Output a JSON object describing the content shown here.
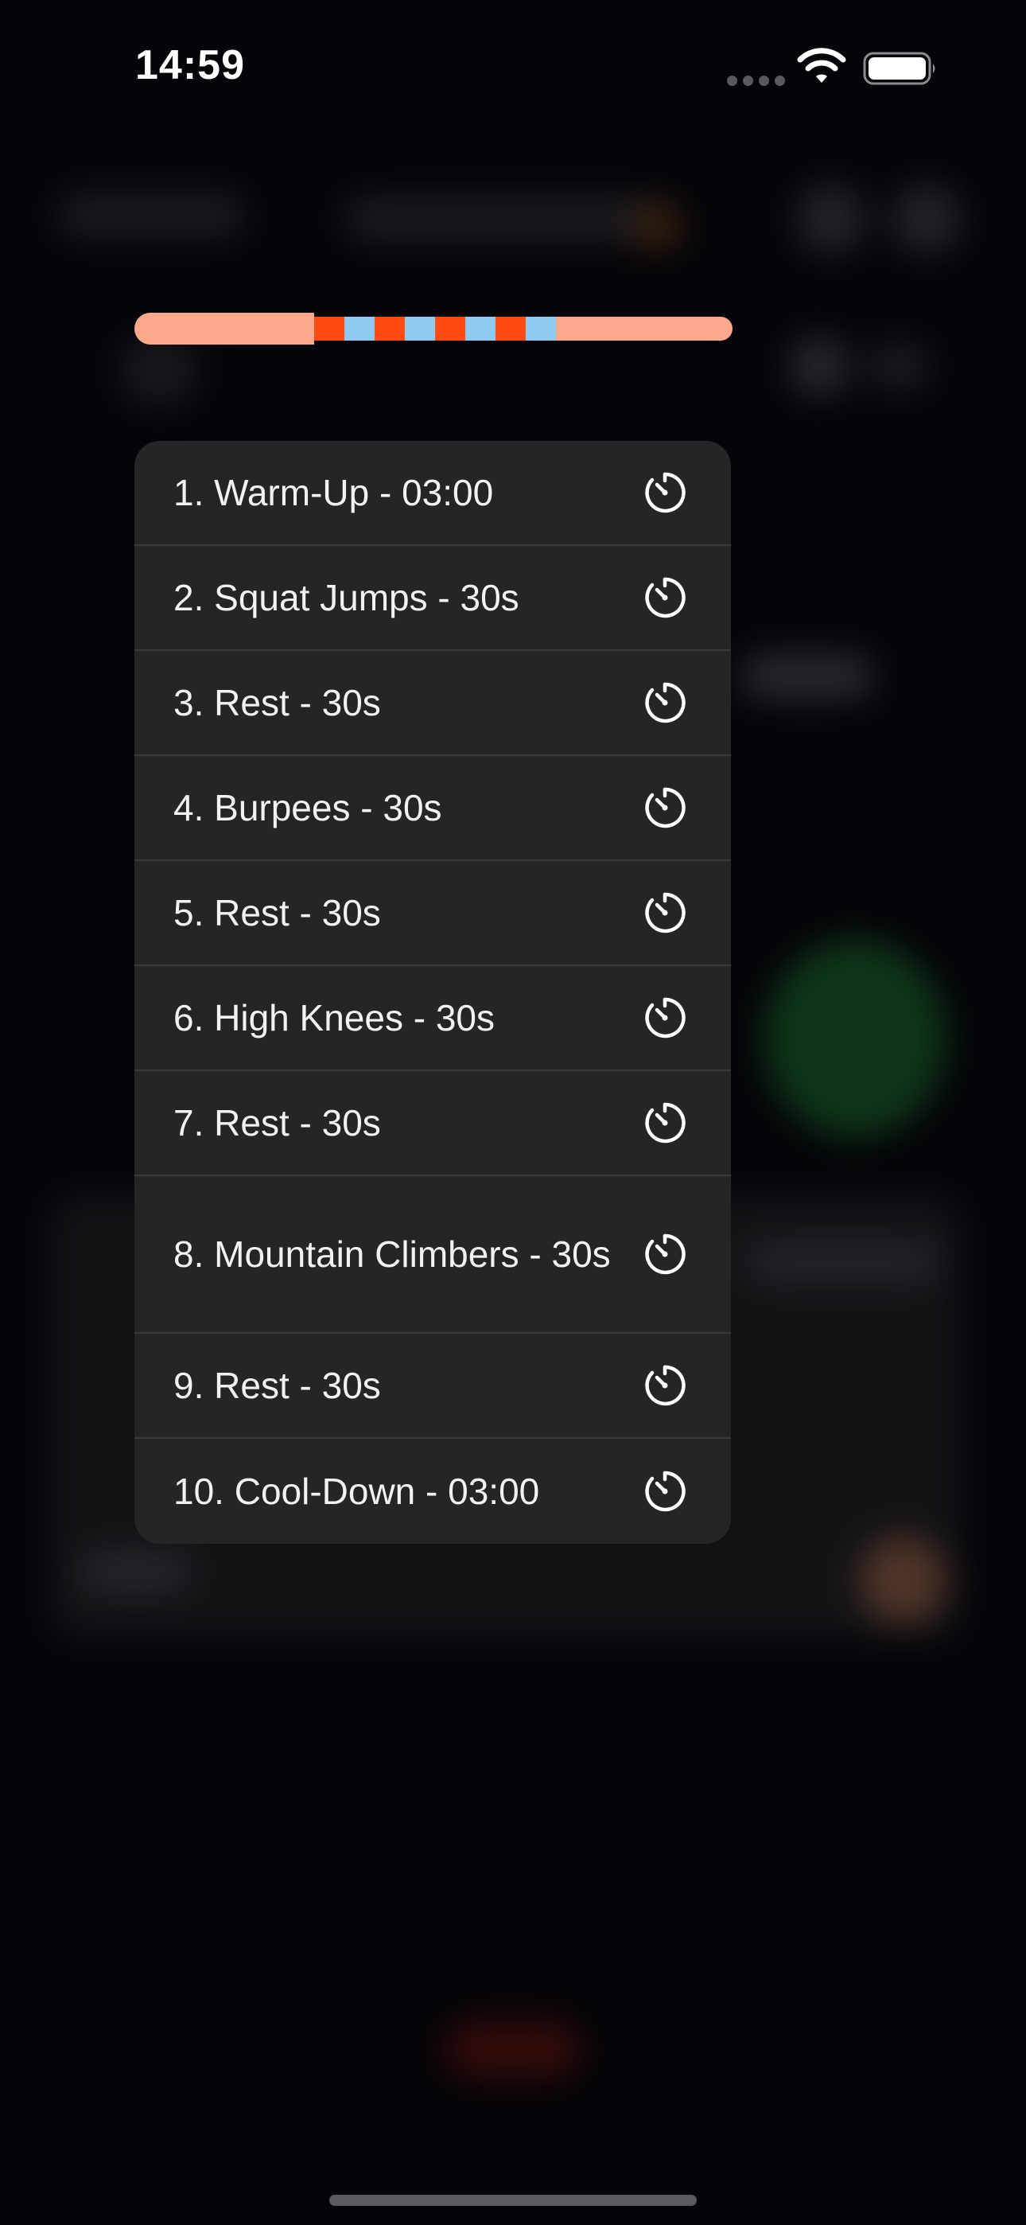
{
  "status_bar": {
    "time": "14:59",
    "icons": [
      "cellular-signal-icon",
      "wifi-icon",
      "battery-icon"
    ]
  },
  "colors": {
    "warmup": "#fba98a",
    "work": "#ff4a10",
    "rest": "#8dcbf1",
    "menu_background": "#252527",
    "separator": "#3a3a3d",
    "text": "#f2f2f4"
  },
  "progress_segments": [
    {
      "kind": "warmup",
      "fraction": 0.3
    },
    {
      "kind": "work",
      "fraction": 0.05
    },
    {
      "kind": "rest",
      "fraction": 0.05
    },
    {
      "kind": "work",
      "fraction": 0.05
    },
    {
      "kind": "rest",
      "fraction": 0.05
    },
    {
      "kind": "work",
      "fraction": 0.05
    },
    {
      "kind": "rest",
      "fraction": 0.05
    },
    {
      "kind": "work",
      "fraction": 0.05
    },
    {
      "kind": "rest",
      "fraction": 0.05
    },
    {
      "kind": "cooldown",
      "fraction": 0.3
    }
  ],
  "menu": {
    "items": [
      {
        "label": "1. Warm-Up - 03:00",
        "icon": "timer-icon"
      },
      {
        "label": "2. Squat Jumps - 30s",
        "icon": "timer-icon"
      },
      {
        "label": "3. Rest - 30s",
        "icon": "timer-icon"
      },
      {
        "label": "4. Burpees - 30s",
        "icon": "timer-icon"
      },
      {
        "label": "5. Rest - 30s",
        "icon": "timer-icon"
      },
      {
        "label": "6. High Knees - 30s",
        "icon": "timer-icon"
      },
      {
        "label": "7. Rest - 30s",
        "icon": "timer-icon"
      },
      {
        "label": "8. Mountain Climbers - 30s",
        "icon": "timer-icon"
      },
      {
        "label": "9. Rest - 30s",
        "icon": "timer-icon"
      },
      {
        "label": "10. Cool-Down - 03:00",
        "icon": "timer-icon"
      }
    ]
  }
}
